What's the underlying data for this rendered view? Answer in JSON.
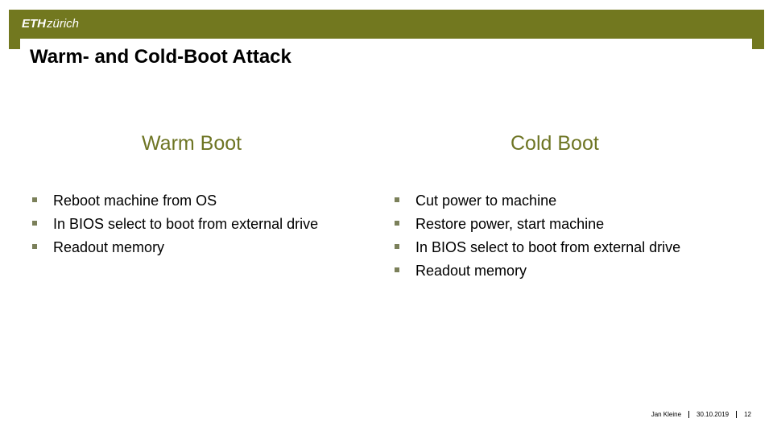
{
  "header": {
    "logo_bold": "ETH",
    "logo_text": "zürich",
    "brand_color": "#72781f"
  },
  "slide": {
    "title": "Warm- and Cold-Boot Attack"
  },
  "columns": {
    "warm": {
      "heading": "Warm Boot",
      "items": [
        "Reboot machine from OS",
        "In BIOS select to boot from external drive",
        "Readout memory"
      ]
    },
    "cold": {
      "heading": "Cold Boot",
      "items": [
        "Cut power to machine",
        "Restore power, start machine",
        "In BIOS select to boot from external drive",
        "Readout memory"
      ]
    }
  },
  "footer": {
    "author": "Jan Kleine",
    "date": "30.10.2019",
    "page_number": "12"
  }
}
